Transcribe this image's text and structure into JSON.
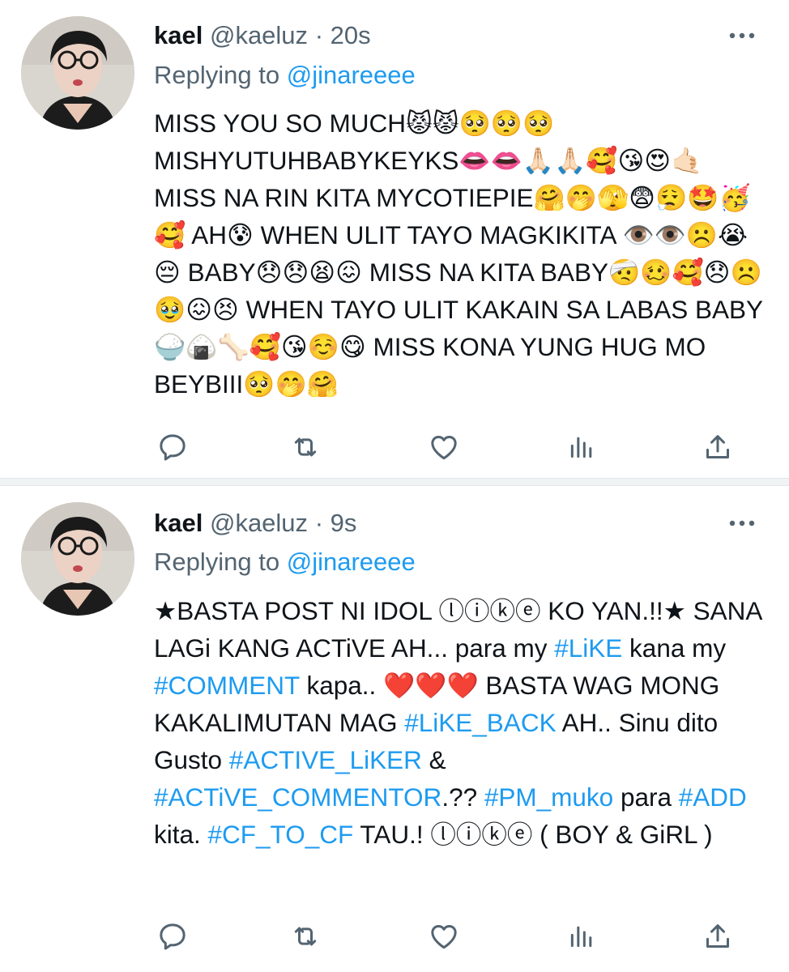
{
  "tweets": [
    {
      "name": "kael",
      "handle": "@kaeluz",
      "separator": "·",
      "time": "20s",
      "replying_label": "Replying to ",
      "replying_to": "@jinareeee",
      "text": "MISS YOU SO MUCH😾😾🥺🥺🥺 MISHYUTUHBABYKEYKS👄👄🙏🏻🙏🏻🥰😘😍🤙🏻 MISS NA RIN KITA MYCOTIEPIE🤗🤭🫣😨😮‍💨🤩🥳🥰 AH😰 WHEN ULIT TAYO MAGKIKITA 👁️👁️☹️😭😔 BABY😞😞😫😖 MISS NA KITA BABY🤕🥴🥰😞☹️🥹😖😣 WHEN TAYO ULIT KAKAIN SA LABAS BABY🍚🍙🦴🥰😘☺️😋 MISS KONA YUNG HUG MO BEYBIII🥺🤭🤗"
    },
    {
      "name": "kael",
      "handle": "@kaeluz",
      "separator": "·",
      "time": "9s",
      "replying_label": "Replying to ",
      "replying_to": "@jinareeee",
      "text_parts": [
        {
          "t": "★BASTA POST NI IDOL ⓛⓘⓚⓔ KO YAN.!!★ SANA LAGi KANG ACTiVE AH... para my ",
          "h": false
        },
        {
          "t": "#LiKE",
          "h": true
        },
        {
          "t": " kana my ",
          "h": false
        },
        {
          "t": "#COMMENT",
          "h": true
        },
        {
          "t": " kapa.. ❤️❤️❤️ BASTA WAG MONG KAKALIMUTAN MAG ",
          "h": false
        },
        {
          "t": "#LiKE_BACK",
          "h": true
        },
        {
          "t": " AH.. Sinu dito Gusto ",
          "h": false
        },
        {
          "t": "#ACTIVE_LiKER",
          "h": true
        },
        {
          "t": " & ",
          "h": false
        },
        {
          "t": "#ACTiVE_COMMENTOR",
          "h": true
        },
        {
          "t": ".?? ",
          "h": false
        },
        {
          "t": "#PM_muko",
          "h": true
        },
        {
          "t": " para ",
          "h": false
        },
        {
          "t": "#ADD",
          "h": true
        },
        {
          "t": " kita. ",
          "h": false
        },
        {
          "t": "#CF_TO_CF",
          "h": true
        },
        {
          "t": " TAU.! ⓛⓘⓚⓔ ( BOY & GiRL )",
          "h": false
        }
      ]
    }
  ],
  "icons": {
    "reply": "reply-icon",
    "retweet": "retweet-icon",
    "like": "like-icon",
    "views": "views-icon",
    "share": "share-icon",
    "more": "more-icon"
  },
  "colors": {
    "accent": "#1d9bf0",
    "secondary_text": "#536471",
    "divider": "#eff3f4"
  }
}
